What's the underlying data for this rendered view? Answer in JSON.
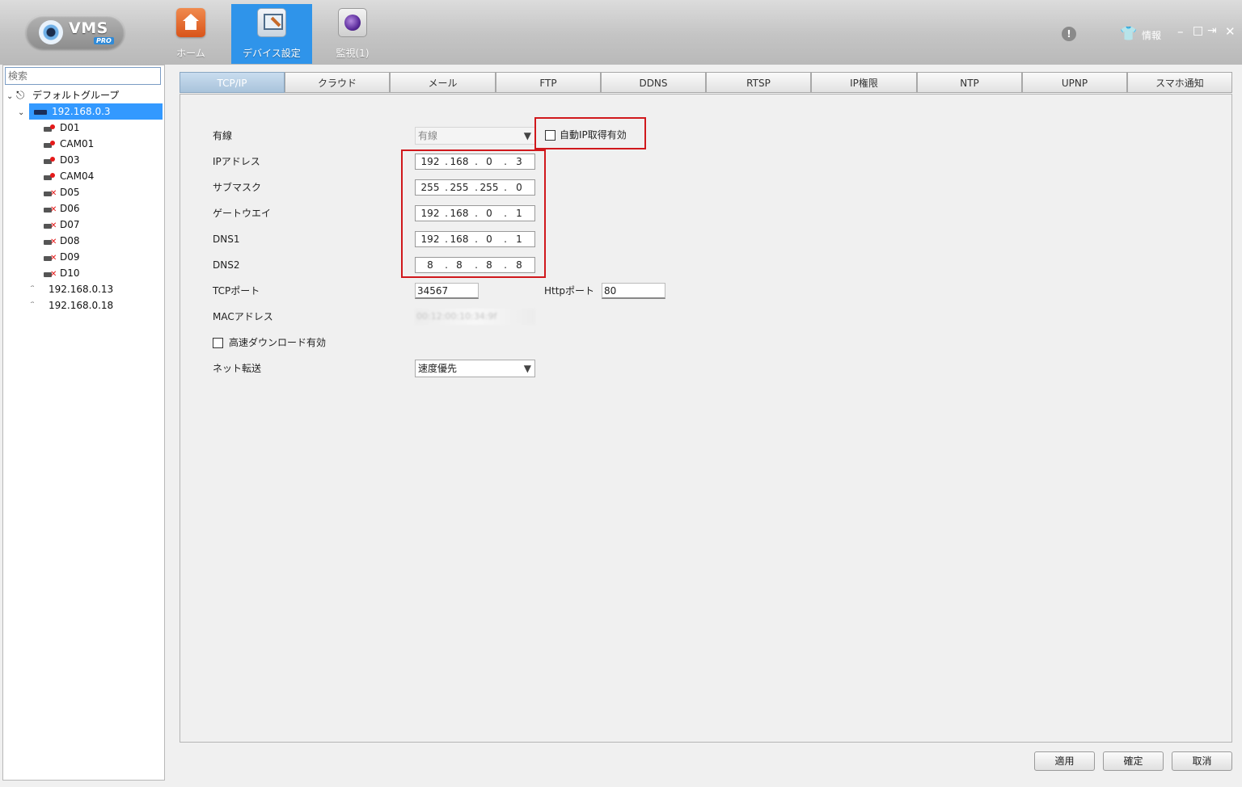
{
  "app": {
    "logo_text": "VMS",
    "logo_badge": "PRO"
  },
  "nav": [
    {
      "label": "ホーム",
      "icon": "home-icon"
    },
    {
      "label": "デバイス設定",
      "icon": "device-settings-icon",
      "active": true
    },
    {
      "label": "監視(1)",
      "icon": "monitor-icon"
    }
  ],
  "titlebar": {
    "alert_glyph": "!",
    "info_label": "情報",
    "minimize": "–",
    "maximize": "□",
    "exit": "⇥",
    "close": "✕"
  },
  "sidebar": {
    "search_placeholder": "検索",
    "group_label": "デフォルトグループ",
    "device_selected": "192.168.0.3",
    "channels": [
      {
        "label": "D01",
        "status": "online"
      },
      {
        "label": "CAM01",
        "status": "online"
      },
      {
        "label": "D03",
        "status": "online"
      },
      {
        "label": "CAM04",
        "status": "online"
      },
      {
        "label": "D05",
        "status": "offline"
      },
      {
        "label": "D06",
        "status": "offline"
      },
      {
        "label": "D07",
        "status": "offline"
      },
      {
        "label": "D08",
        "status": "offline"
      },
      {
        "label": "D09",
        "status": "offline"
      },
      {
        "label": "D10",
        "status": "offline"
      }
    ],
    "other_devices": [
      "192.168.0.13",
      "192.168.0.18"
    ]
  },
  "tabs": [
    "TCP/IP",
    "クラウド",
    "メール",
    "FTP",
    "DDNS",
    "RTSP",
    "IP権限",
    "NTP",
    "UPNP",
    "スマホ通知"
  ],
  "form": {
    "wired_label": "有線",
    "wired_value": "有線",
    "dhcp_label": "自動IP取得有効",
    "ip_label": "IPアドレス",
    "ip": [
      "192",
      "168",
      "0",
      "3"
    ],
    "subnet_label": "サブマスク",
    "subnet": [
      "255",
      "255",
      "255",
      "0"
    ],
    "gateway_label": "ゲートウエイ",
    "gateway": [
      "192",
      "168",
      "0",
      "1"
    ],
    "dns1_label": "DNS1",
    "dns1": [
      "192",
      "168",
      "0",
      "1"
    ],
    "dns2_label": "DNS2",
    "dns2": [
      "8",
      "8",
      "8",
      "8"
    ],
    "tcp_port_label": "TCPポート",
    "tcp_port": "34567",
    "http_port_label": "Httpポート",
    "http_port": "80",
    "mac_label": "MACアドレス",
    "mac_value": "00:12:00:10:34:9f",
    "hs_download_label": "高速ダウンロード有効",
    "net_transfer_label": "ネット転送",
    "net_transfer_value": "速度優先",
    "dot": "."
  },
  "buttons": {
    "apply": "適用",
    "ok": "確定",
    "cancel": "取消"
  },
  "colors": {
    "accent": "#2f94ea",
    "selection": "#3399ff",
    "highlight_box": "#d0181c"
  }
}
